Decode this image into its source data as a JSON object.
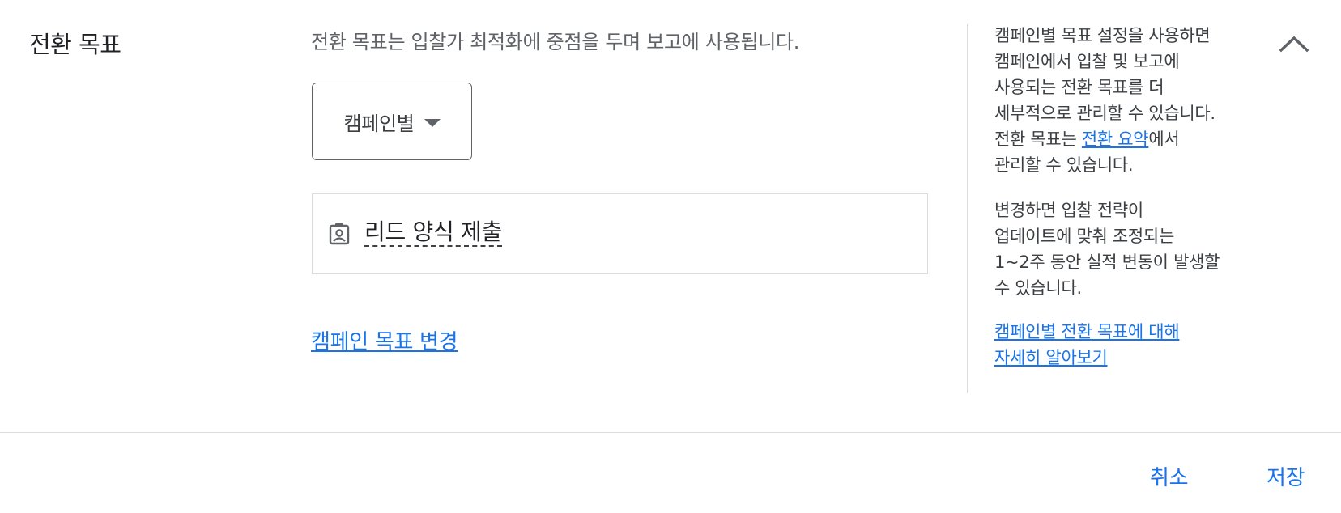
{
  "section": {
    "title": "전환 목표",
    "description": "전환 목표는 입찰가 최적화에 중점을 두며 보고에 사용됩니다."
  },
  "dropdown": {
    "selected": "캠페인별"
  },
  "goal": {
    "icon": "lead-form-icon",
    "label": "리드 양식 제출"
  },
  "change_link": "캠페인 목표 변경",
  "help": {
    "para1_lines": [
      "캠페인별 목표 설정을 사용하면",
      "캠페인에서 입찰 및 보고에",
      "사용되는 전환 목표를 더",
      "세부적으로 관리할 수 있습니다."
    ],
    "para1_prefix": "전환 목표는 ",
    "para1_link": "전환 요약",
    "para1_suffix": "에서",
    "para1_last": "관리할 수 있습니다.",
    "para2_lines": [
      "변경하면 입찰 전략이",
      "업데이트에 맞춰 조정되는",
      "1~2주 동안 실적 변동이 발생할",
      "수 있습니다."
    ],
    "learn_more_line1": "캠페인별 전환 목표에 대해",
    "learn_more_line2": "자세히 알아보기",
    "collapse_icon": "chevron-up-icon"
  },
  "footer": {
    "cancel": "취소",
    "save": "저장"
  },
  "colors": {
    "link": "#1a73e8",
    "text_primary": "#202124",
    "text_secondary": "#5f6368",
    "divider": "#dadce0"
  }
}
